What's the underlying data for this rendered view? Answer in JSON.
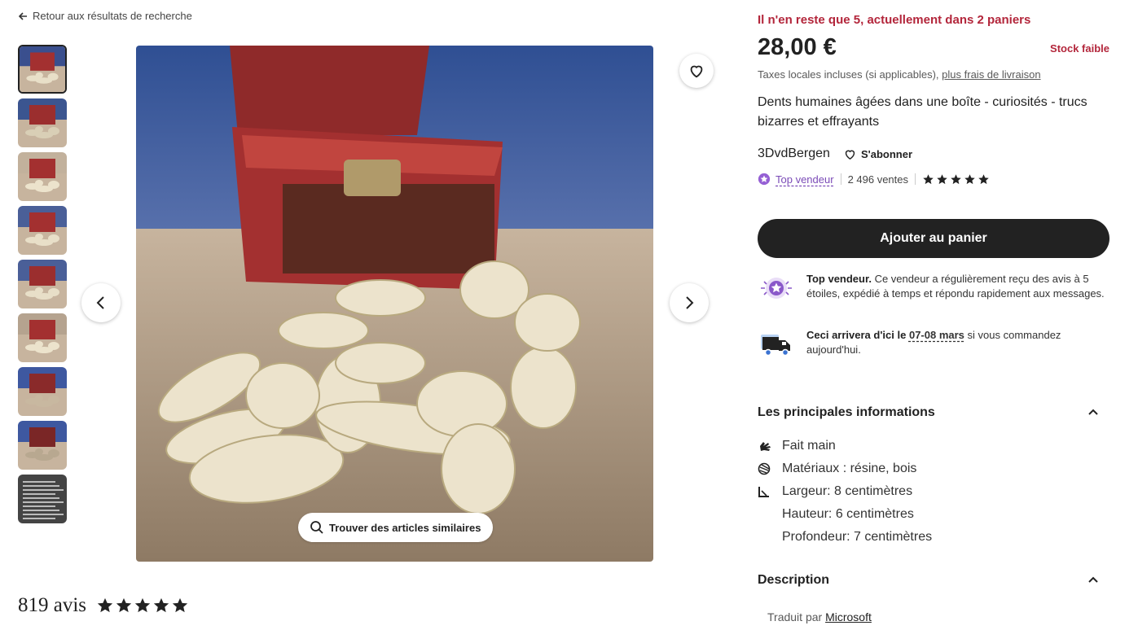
{
  "back_link": "Retour aux résultats de recherche",
  "gallery": {
    "thumbnail_count": 9,
    "selected_index": 0,
    "similar_button": "Trouver des articles similaires"
  },
  "reviews": {
    "count_label": "819 avis",
    "rating": 5
  },
  "listing": {
    "alert": "Il n'en reste que 5, actuellement dans 2 paniers",
    "price": "28,00 €",
    "stock": "Stock faible",
    "tax_prefix": "Taxes locales incluses (si applicables),",
    "tax_link": "plus frais de livraison",
    "title": "Dents humaines âgées dans une boîte - curiosités - trucs bizarres et effrayants"
  },
  "shop": {
    "name": "3DvdBergen",
    "follow": "S'abonner",
    "badge": "Top vendeur",
    "sales": "2 496 ventes",
    "rating": 5
  },
  "cart_button": "Ajouter au panier",
  "seller_info": {
    "title": "Top vendeur.",
    "text": "Ce vendeur a régulièrement reçu des avis à 5 étoiles, expédié à temps et répondu rapidement aux messages."
  },
  "delivery_info": {
    "prefix": "Ceci arrivera d'ici le",
    "dates": "07-08 mars",
    "suffix": "si vous commandez aujourd'hui."
  },
  "highlights": {
    "heading": "Les principales informations",
    "items": [
      {
        "icon": "hand-icon",
        "text": "Fait main"
      },
      {
        "icon": "material-icon",
        "text": "Matériaux : résine, bois"
      },
      {
        "icon": "ruler-icon",
        "text": "Largeur: 8 centimètres"
      },
      {
        "icon": "",
        "text": "Hauteur: 6 centimètres"
      },
      {
        "icon": "",
        "text": "Profondeur: 7 centimètres"
      }
    ]
  },
  "description": {
    "heading": "Description",
    "translated_prefix": "Traduit par",
    "translator": "Microsoft"
  },
  "colors": {
    "alert": "#b3263b",
    "badge": "#7b4bb7",
    "cart": "#222222"
  }
}
